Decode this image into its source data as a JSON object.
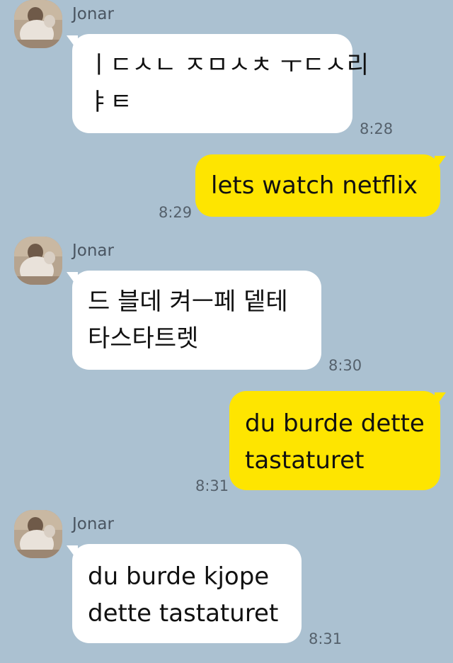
{
  "colors": {
    "background": "#abc1d1",
    "incoming_bubble": "#ffffff",
    "outgoing_bubble": "#fee500"
  },
  "messages": [
    {
      "sender": "Jonar",
      "avatar": "profile-photo",
      "lines": [
        "ㅣㄷㅅㄴ ㅈㅁㅅㅊ ㅜㄷㅅ리",
        "ㅑㅌ"
      ],
      "time": "8:28"
    },
    {
      "sender": "",
      "lines": [
        "lets watch netflix"
      ],
      "time": "8:29"
    },
    {
      "sender": "Jonar",
      "avatar": "profile-photo",
      "lines": [
        "드 블데 켜ㅡ페 뎉테",
        "타스타트렛"
      ],
      "time": "8:30"
    },
    {
      "sender": "",
      "lines": [
        "du burde dette",
        "tastaturet"
      ],
      "time": "8:31"
    },
    {
      "sender": "Jonar",
      "avatar": "profile-photo",
      "lines": [
        "du burde kjope",
        "dette tastaturet"
      ],
      "time": "8:31"
    }
  ]
}
